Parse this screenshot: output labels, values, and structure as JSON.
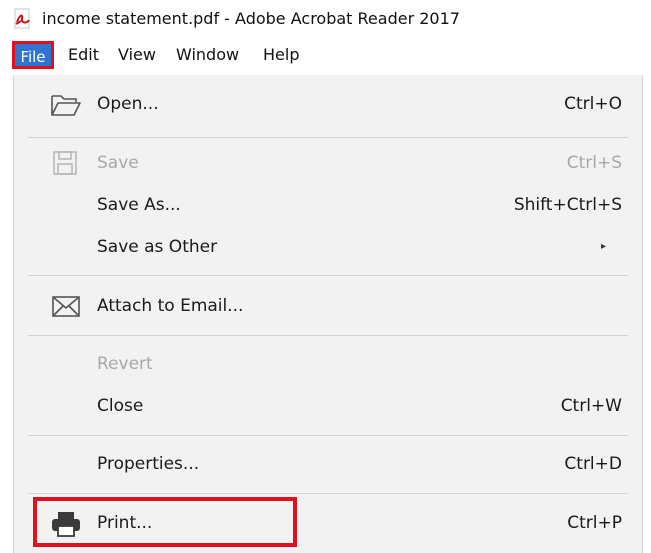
{
  "window": {
    "title": "income statement.pdf - Adobe Acrobat Reader 2017"
  },
  "menubar": {
    "items": [
      "File",
      "Edit",
      "View",
      "Window",
      "Help"
    ]
  },
  "file_menu": {
    "items": [
      {
        "label": "Open...",
        "shortcut": "Ctrl+O",
        "icon": "folder-open-icon",
        "enabled": true
      },
      {
        "label": "Save",
        "shortcut": "Ctrl+S",
        "icon": "save-disk-icon",
        "enabled": false
      },
      {
        "label": "Save As...",
        "shortcut": "Shift+Ctrl+S",
        "enabled": true
      },
      {
        "label": "Save as Other",
        "submenu_arrow": "▸",
        "enabled": true
      },
      {
        "label": "Attach to Email...",
        "icon": "envelope-icon",
        "enabled": true
      },
      {
        "label": "Revert",
        "enabled": false
      },
      {
        "label": "Close",
        "shortcut": "Ctrl+W",
        "enabled": true
      },
      {
        "label": "Properties...",
        "shortcut": "Ctrl+D",
        "enabled": true
      },
      {
        "label": "Print...",
        "shortcut": "Ctrl+P",
        "icon": "printer-icon",
        "enabled": true
      }
    ]
  },
  "colors": {
    "file_menu_active_bg": "#2f74d0",
    "highlight_border": "#e0101e",
    "menu_bg": "#f2f2f2",
    "disabled_text": "#a8a8a8"
  }
}
